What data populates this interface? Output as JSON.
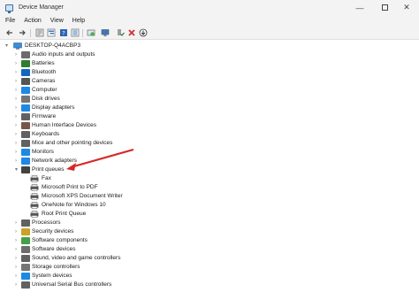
{
  "window": {
    "title": "Device Manager",
    "minimize": "—",
    "close": "✕"
  },
  "menu": [
    "File",
    "Action",
    "View",
    "Help"
  ],
  "toolbar_icons": [
    "back-icon",
    "forward-icon",
    "properties-icon",
    "tree-icon",
    "help-icon",
    "view-icon",
    "update-driver-icon",
    "scan-icon",
    "enable-device-icon",
    "uninstall-icon",
    "download-icon"
  ],
  "tree": {
    "root": "DESKTOP-Q4ACBP3",
    "categories": [
      {
        "label": "Audio inputs and outputs",
        "icon": "speaker-icon",
        "color": "#6b6b6b"
      },
      {
        "label": "Batteries",
        "icon": "battery-icon",
        "color": "#2e7d32"
      },
      {
        "label": "Bluetooth",
        "icon": "bluetooth-icon",
        "color": "#1565c0"
      },
      {
        "label": "Cameras",
        "icon": "camera-icon",
        "color": "#555555"
      },
      {
        "label": "Computer",
        "icon": "computer-icon",
        "color": "#1e88e5"
      },
      {
        "label": "Disk drives",
        "icon": "disk-icon",
        "color": "#757575"
      },
      {
        "label": "Display adapters",
        "icon": "display-icon",
        "color": "#1e88e5"
      },
      {
        "label": "Firmware",
        "icon": "firmware-icon",
        "color": "#616161"
      },
      {
        "label": "Human Interface Devices",
        "icon": "hid-icon",
        "color": "#795548"
      },
      {
        "label": "Keyboards",
        "icon": "keyboard-icon",
        "color": "#616161"
      },
      {
        "label": "Mice and other pointing devices",
        "icon": "mouse-icon",
        "color": "#616161"
      },
      {
        "label": "Monitors",
        "icon": "monitor-icon",
        "color": "#1e88e5"
      },
      {
        "label": "Network adapters",
        "icon": "network-icon",
        "color": "#1e88e5"
      },
      {
        "label": "Print queues",
        "icon": "printer-icon",
        "color": "#424242",
        "expanded": true,
        "children": [
          {
            "label": "Fax",
            "icon": "printer-icon"
          },
          {
            "label": "Microsoft Print to PDF",
            "icon": "printer-icon"
          },
          {
            "label": "Microsoft XPS Document Writer",
            "icon": "printer-icon"
          },
          {
            "label": "OneNote for Windows 10",
            "icon": "printer-icon"
          },
          {
            "label": "Root Print Queue",
            "icon": "printer-icon"
          }
        ]
      },
      {
        "label": "Processors",
        "icon": "processor-icon",
        "color": "#616161"
      },
      {
        "label": "Security devices",
        "icon": "security-icon",
        "color": "#c9a227"
      },
      {
        "label": "Software components",
        "icon": "software-component-icon",
        "color": "#43a047"
      },
      {
        "label": "Software devices",
        "icon": "software-device-icon",
        "color": "#6d6d6d"
      },
      {
        "label": "Sound, video and game controllers",
        "icon": "sound-icon",
        "color": "#616161"
      },
      {
        "label": "Storage controllers",
        "icon": "storage-icon",
        "color": "#757575"
      },
      {
        "label": "System devices",
        "icon": "system-icon",
        "color": "#1e88e5"
      },
      {
        "label": "Universal Serial Bus controllers",
        "icon": "usb-icon",
        "color": "#616161"
      }
    ]
  },
  "annotation": {
    "color": "#d62828"
  }
}
